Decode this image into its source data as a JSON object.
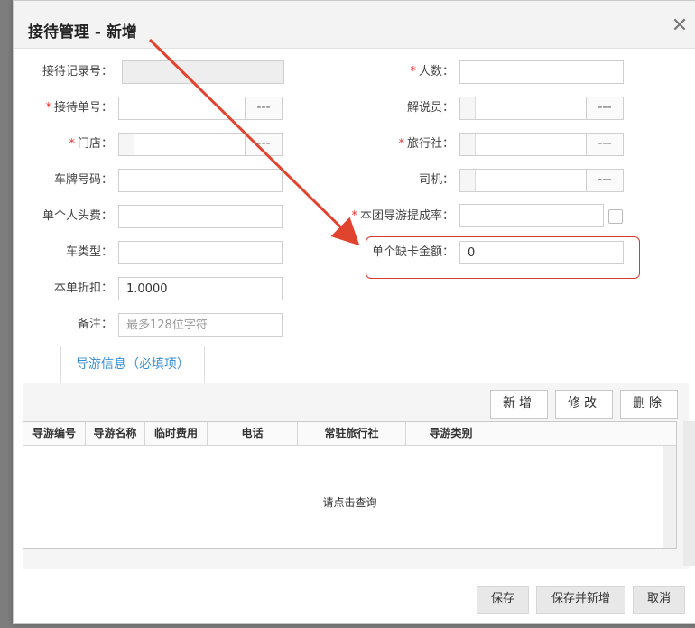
{
  "dialog": {
    "title": "接待管理 - 新增",
    "close_icon": "close-icon"
  },
  "form": {
    "left": [
      {
        "label": "接待记录号",
        "required": false,
        "value": "",
        "placeholder": "",
        "disabled": true
      },
      {
        "label": "接待单号",
        "required": true,
        "value": "",
        "placeholder": "",
        "lookup": true
      },
      {
        "label": "门店",
        "required": true,
        "value": "",
        "placeholder": "",
        "lookup": true
      },
      {
        "label": "车牌号码",
        "required": false,
        "value": "",
        "placeholder": ""
      },
      {
        "label": "单个人头费",
        "required": false,
        "value": "",
        "placeholder": ""
      },
      {
        "label": "车类型",
        "required": false,
        "value": "",
        "placeholder": ""
      },
      {
        "label": "本单折扣",
        "required": false,
        "value": "1.0000",
        "placeholder": ""
      },
      {
        "label": "备注",
        "required": false,
        "value": "",
        "placeholder": "最多128位字符"
      }
    ],
    "right": [
      {
        "label": "人数",
        "required": true,
        "value": ""
      },
      {
        "label": "解说员",
        "required": false,
        "value": "",
        "lookup": true
      },
      {
        "label": "旅行社",
        "required": true,
        "value": "",
        "lookup": true
      },
      {
        "label": "司机",
        "required": false,
        "value": "",
        "lookup": true
      },
      {
        "label": "本团导游提成率",
        "required": true,
        "value": "",
        "checkbox": true
      },
      {
        "label": "单个缺卡金额",
        "required": false,
        "value": "0",
        "highlighted": true
      }
    ],
    "lookup_symbol": "---"
  },
  "tabs": [
    {
      "label": "导游信息（必填项）",
      "active": true
    }
  ],
  "toolbar": {
    "add": "新增",
    "edit": "修改",
    "delete": "删除"
  },
  "grid": {
    "columns": [
      "导游编号",
      "导游名称",
      "临时费用",
      "电话",
      "常驻旅行社",
      "导游类别"
    ],
    "empty_text": "请点击查询"
  },
  "footer": {
    "save": "保存",
    "save_new": "保存并新增",
    "cancel": "取消"
  },
  "colors": {
    "accent": "#3a8fd3",
    "required": "#e33333",
    "annotation": "#d43a2f"
  }
}
